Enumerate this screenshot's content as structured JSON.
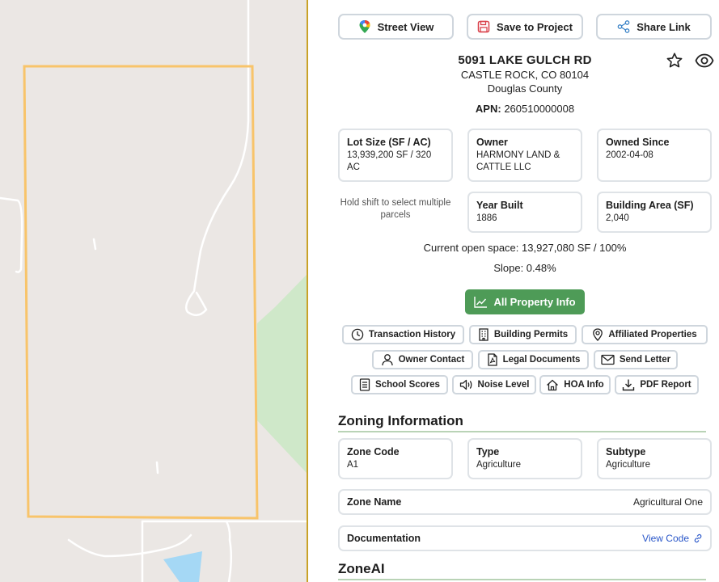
{
  "toolbar": {
    "street_view": "Street View",
    "save_project": "Save to Project",
    "share_link": "Share Link"
  },
  "property": {
    "address": "5091 LAKE GULCH RD",
    "city_state_zip": "CASTLE ROCK, CO 80104",
    "county": "Douglas County",
    "apn_label": "APN:",
    "apn_value": "260510000008"
  },
  "cards": {
    "lot_size": {
      "label": "Lot Size (SF / AC)",
      "value": "13,939,200 SF / 320 AC"
    },
    "owner": {
      "label": "Owner",
      "value": "HARMONY LAND & CATTLE LLC"
    },
    "owned_since": {
      "label": "Owned Since",
      "value": "2002-04-08"
    },
    "year_built": {
      "label": "Year Built",
      "value": "1886"
    },
    "building_area": {
      "label": "Building Area (SF)",
      "value": "2,040"
    }
  },
  "hint": "Hold shift to select multiple parcels",
  "stats": {
    "open_space": "Current open space: 13,927,080 SF / 100%",
    "slope": "Slope: 0.48%"
  },
  "all_info": "All Property Info",
  "chips": {
    "transaction_history": "Transaction History",
    "building_permits": "Building Permits",
    "affiliated_properties": "Affiliated Properties",
    "owner_contact": "Owner Contact",
    "legal_documents": "Legal Documents",
    "send_letter": "Send Letter",
    "school_scores": "School Scores",
    "noise_level": "Noise Level",
    "hoa_info": "HOA Info",
    "pdf_report": "PDF Report"
  },
  "zoning": {
    "title": "Zoning Information",
    "zone_code": {
      "label": "Zone Code",
      "value": "A1"
    },
    "type": {
      "label": "Type",
      "value": "Agriculture"
    },
    "subtype": {
      "label": "Subtype",
      "value": "Agriculture"
    },
    "zone_name": {
      "label": "Zone Name",
      "value": "Agricultural One"
    },
    "documentation": {
      "label": "Documentation",
      "link": "View Code"
    }
  },
  "zoneai": {
    "title": "ZoneAI"
  },
  "colors": {
    "parcel_outline": "#f8c46a",
    "map_background": "#ebe7e4",
    "park_green": "#cfe8c9",
    "water": "#a5d8f5",
    "accent_green": "#4e9b57",
    "link_blue": "#2a57c9"
  }
}
